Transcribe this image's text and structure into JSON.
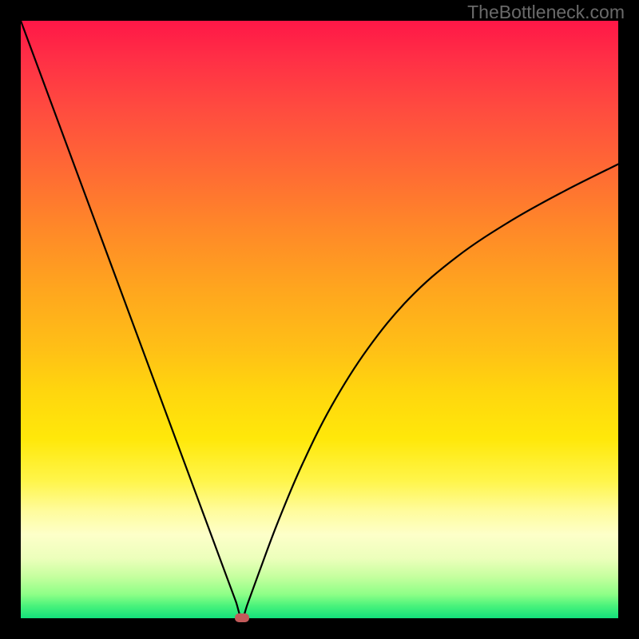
{
  "watermark": "TheBottleneck.com",
  "chart_data": {
    "type": "line",
    "title": "",
    "xlabel": "",
    "ylabel": "",
    "xlim": [
      0,
      100
    ],
    "ylim": [
      0,
      100
    ],
    "grid": false,
    "legend": false,
    "annotations": [
      {
        "name": "minimum-marker",
        "x": 37,
        "y": 0,
        "color": "#c25a5a"
      }
    ],
    "background_gradient": [
      {
        "pos": 0,
        "color": "#ff1747"
      },
      {
        "pos": 50,
        "color": "#ffb018"
      },
      {
        "pos": 80,
        "color": "#fffc9c"
      },
      {
        "pos": 100,
        "color": "#13e07b"
      }
    ],
    "series": [
      {
        "name": "bottleneck-curve",
        "color": "#000000",
        "x": [
          0,
          5,
          10,
          15,
          20,
          25,
          30,
          33,
          35,
          36,
          37,
          38,
          40,
          43,
          47,
          52,
          58,
          65,
          73,
          82,
          91,
          100
        ],
        "y": [
          100,
          86.5,
          73,
          59.5,
          46,
          32.5,
          19,
          10.9,
          5.5,
          2.8,
          0,
          2.5,
          8,
          16,
          25.5,
          35.5,
          45,
          53.5,
          60.5,
          66.5,
          71.5,
          76
        ]
      }
    ]
  }
}
